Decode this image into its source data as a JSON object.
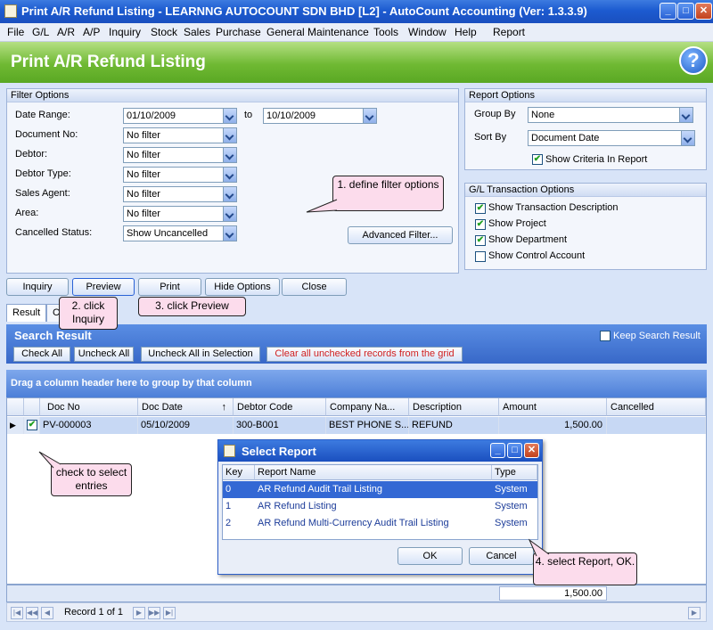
{
  "window": {
    "title": "Print A/R Refund Listing - LEARNNG AUTOCOUNT SDN BHD [L2] - AutoCount Accounting (Ver: 1.3.3.9)"
  },
  "menu": [
    "File",
    "G/L",
    "A/R",
    "A/P",
    "Inquiry",
    "Stock",
    "Sales",
    "Purchase",
    "General Maintenance",
    "Tools",
    "Window",
    "Help",
    "Report"
  ],
  "banner": {
    "title": "Print A/R Refund Listing",
    "help_label": "?"
  },
  "filter": {
    "title": "Filter Options",
    "date_range_label": "Date Range:",
    "date_from": "01/10/2009",
    "to_label": "to",
    "date_to": "10/10/2009",
    "document_no_label": "Document No:",
    "document_no": "No filter",
    "debtor_label": "Debtor:",
    "debtor": "No filter",
    "debtor_type_label": "Debtor Type:",
    "debtor_type": "No filter",
    "sales_agent_label": "Sales Agent:",
    "sales_agent": "No filter",
    "area_label": "Area:",
    "area": "No filter",
    "cancelled_status_label": "Cancelled Status:",
    "cancelled_status": "Show Uncancelled",
    "advanced_filter": "Advanced Filter..."
  },
  "report_options": {
    "title": "Report Options",
    "group_by_label": "Group By",
    "group_by": "None",
    "sort_by_label": "Sort By",
    "sort_by": "Document Date",
    "show_criteria": "Show Criteria In Report"
  },
  "gl_options": {
    "title": "G/L Transaction Options",
    "items": [
      "Show Transaction Description",
      "Show Project",
      "Show Department",
      "Show Control Account"
    ],
    "checked": [
      true,
      true,
      true,
      false
    ]
  },
  "actions": {
    "inquiry": "Inquiry",
    "preview": "Preview",
    "print": "Print",
    "hide_options": "Hide Options",
    "close": "Close"
  },
  "callouts": {
    "c1": "1. define filter options",
    "c2": "2. click Inquiry",
    "c3": "3. click Preview",
    "c4": "check to select entries",
    "c5": "4. select Report, OK."
  },
  "tabs": {
    "result": "Result",
    "criteria": "C"
  },
  "search": {
    "title": "Search Result",
    "keep": "Keep Search Result",
    "check_all": "Check All",
    "uncheck_all": "Uncheck All",
    "uncheck_in_selection": "Uncheck All in Selection",
    "clear_unchecked": "Clear all unchecked records from the grid",
    "group_hint": "Drag a column header here to group by that column"
  },
  "grid": {
    "columns": [
      "Doc No",
      "Doc Date",
      "Debtor Code",
      "Company Na...",
      "Description",
      "Amount",
      "Cancelled"
    ],
    "rows": [
      {
        "doc_no": "PV-000003",
        "doc_date": "05/10/2009",
        "debtor_code": "300-B001",
        "company": "BEST PHONE S...",
        "description": "REFUND",
        "amount": "1,500.00",
        "cancelled": ""
      }
    ],
    "total": "1,500.00",
    "record_label": "Record 1 of 1"
  },
  "dialog": {
    "title": "Select Report",
    "col_key": "Key",
    "col_name": "Report Name",
    "col_type": "Type",
    "rows": [
      {
        "key": "0",
        "name": "AR Refund Audit Trail Listing",
        "type": "System"
      },
      {
        "key": "1",
        "name": "AR Refund Listing",
        "type": "System"
      },
      {
        "key": "2",
        "name": "AR Refund Multi-Currency Audit Trail Listing",
        "type": "System"
      }
    ],
    "ok": "OK",
    "cancel": "Cancel"
  },
  "colors": {
    "title_bar": "#1c5bd0",
    "banner_green": "#6fb933",
    "callout": "#fcdcec",
    "selection": "#3368d4"
  }
}
